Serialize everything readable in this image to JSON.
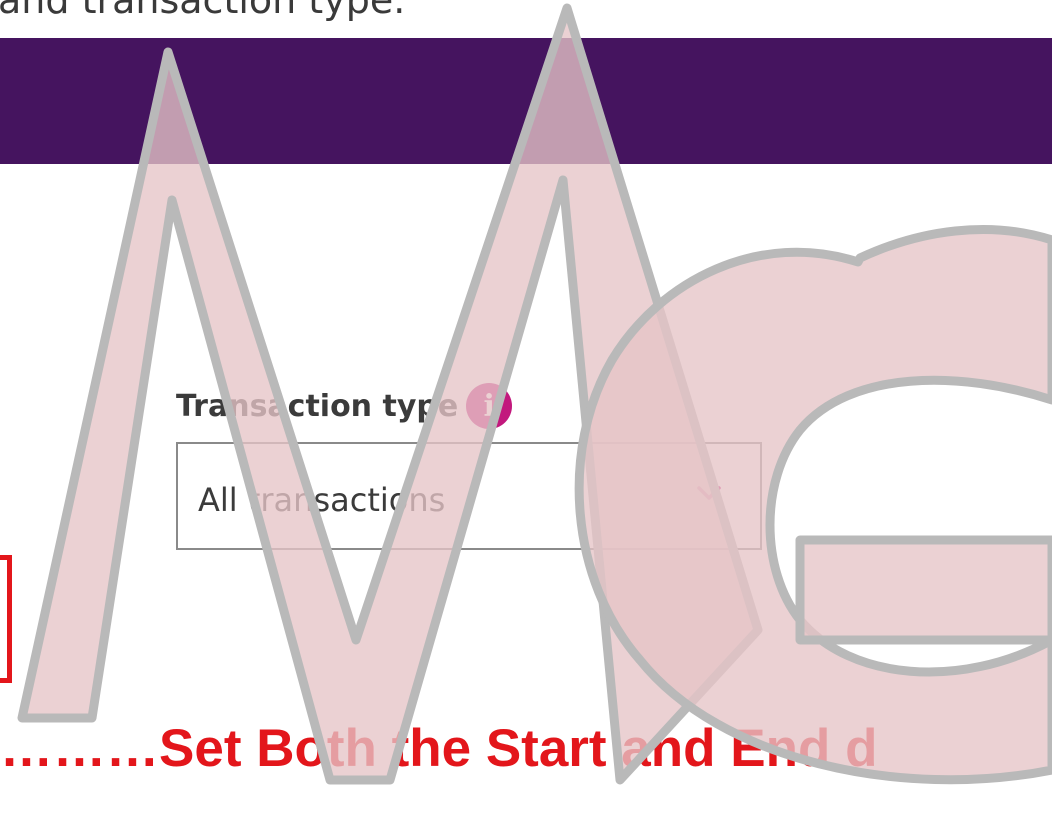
{
  "header": {
    "clipped_text": "and transaction type."
  },
  "transaction_filter": {
    "label": "Transaction type",
    "info_icon": "info-icon",
    "selected_value": "All transactions",
    "chevron_icon": "chevron-down-icon"
  },
  "annotation": {
    "instruction_text": "………Set Both the Start and End d"
  },
  "watermark": {
    "logo_name": "mg-logo-watermark",
    "letters": "MG"
  },
  "colors": {
    "banner": "#45145f",
    "info_icon": "#c2187d",
    "chevron": "#c2187d",
    "annotation_red": "#e3161b",
    "watermark_fill": "#e6c4c7",
    "watermark_outline": "#b9b9b9"
  }
}
